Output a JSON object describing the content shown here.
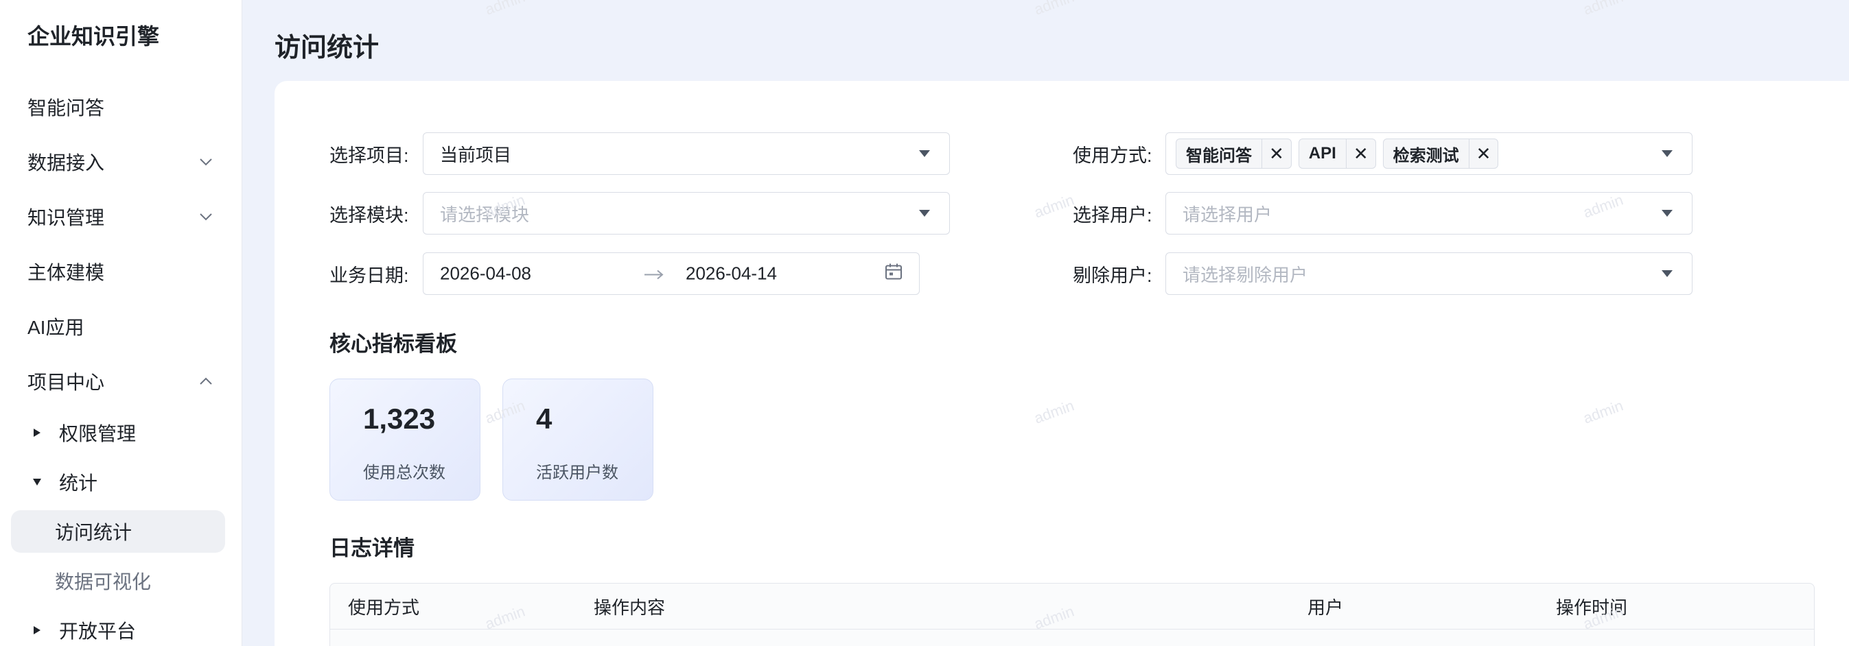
{
  "sidebar": {
    "brand": "企业知识引擎",
    "items": [
      {
        "label": "智能问答"
      },
      {
        "label": "数据接入"
      },
      {
        "label": "知识管理"
      },
      {
        "label": "主体建模"
      },
      {
        "label": "AI应用"
      },
      {
        "label": "项目中心"
      }
    ],
    "sub_items": [
      {
        "label": "权限管理"
      },
      {
        "label": "统计"
      },
      {
        "label": "访问统计"
      },
      {
        "label": "数据可视化"
      },
      {
        "label": "开放平台"
      }
    ]
  },
  "page": {
    "title": "访问统计"
  },
  "filters": {
    "project_label": "选择项目:",
    "project_value": "当前项目",
    "module_label": "选择模块:",
    "module_placeholder": "请选择模块",
    "date_label": "业务日期:",
    "date_start": "2026-04-08",
    "date_end": "2026-04-14",
    "usage_label": "使用方式:",
    "usage_tags": [
      "智能问答",
      "API",
      "检索测试"
    ],
    "user_label": "选择用户:",
    "user_placeholder": "请选择用户",
    "exclude_label": "剔除用户:",
    "exclude_placeholder": "请选择剔除用户"
  },
  "dashboard": {
    "title": "核心指标看板",
    "metrics": [
      {
        "value": "1,323",
        "label": "使用总次数"
      },
      {
        "value": "4",
        "label": "活跃用户数"
      }
    ]
  },
  "logs": {
    "title": "日志详情",
    "columns": [
      "使用方式",
      "操作内容",
      "用户",
      "操作时间"
    ]
  },
  "watermark": "admin",
  "icons": {
    "chevron_down": "chevron-down-icon",
    "chevron_up": "chevron-up-icon",
    "caret_right": "caret-right-icon",
    "caret_down": "caret-down-icon",
    "calendar": "calendar-icon",
    "close": "close-icon"
  }
}
